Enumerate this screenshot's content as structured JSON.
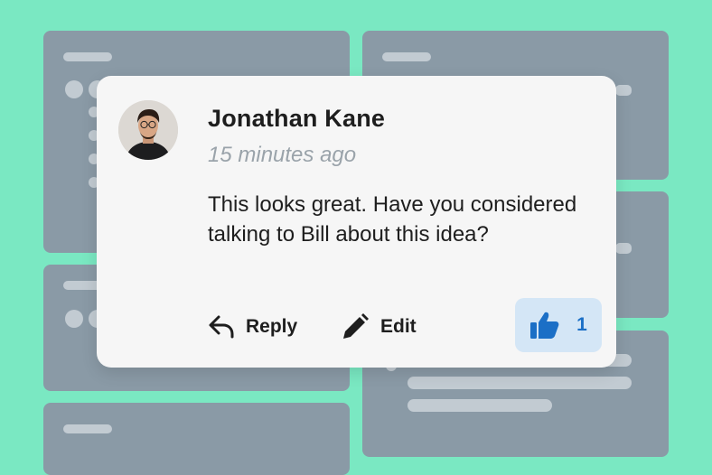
{
  "comment": {
    "author": "Jonathan Kane",
    "timestamp": "15 minutes ago",
    "text": "This looks great. Have you considered talking to Bill about this idea?",
    "avatar": "avatar-photo"
  },
  "actions": {
    "reply_label": "Reply",
    "reply_icon": "reply-arrow-icon",
    "edit_label": "Edit",
    "edit_icon": "pencil-icon",
    "like_icon": "thumbs-up-icon",
    "like_count": "1"
  },
  "colors": {
    "background": "#7ae8c2",
    "placeholder_card": "#8a9aa6",
    "card": "#f6f6f6",
    "like_bg": "#d4e6f6",
    "like_accent": "#1b6fc6"
  }
}
